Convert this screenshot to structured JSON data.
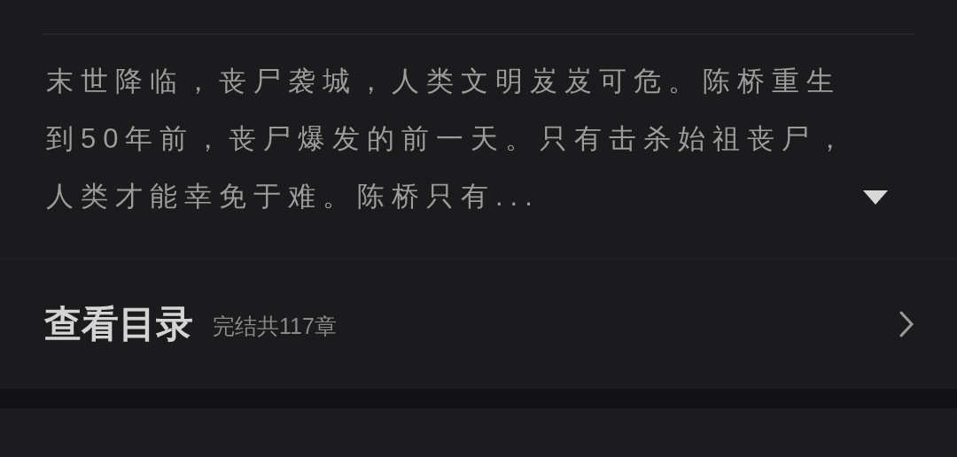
{
  "synopsis": {
    "text": "末世降临，丧尸袭城，人类文明岌岌可危。陈桥重生到50年前，丧尸爆发的前一天。只有击杀始祖丧尸，人类才能幸免于难。陈桥只有...",
    "expanded": false
  },
  "catalog": {
    "title": "查看目录",
    "status": "完结共117章"
  }
}
